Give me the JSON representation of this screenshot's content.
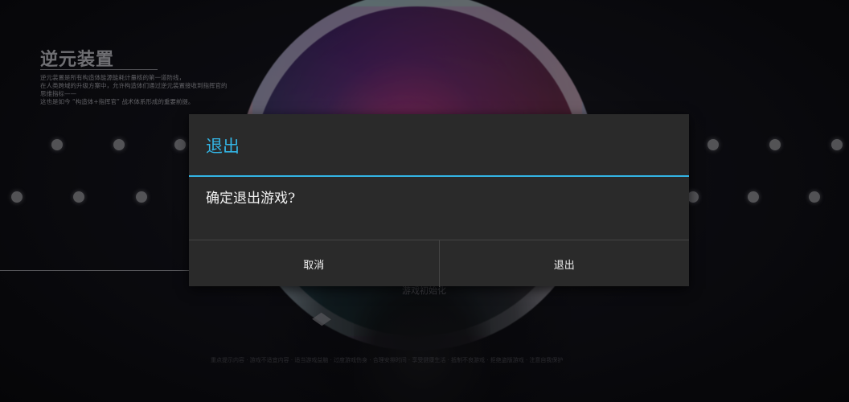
{
  "background": {
    "intro_title": "逆元装置",
    "intro_lines": [
      "逆元装置是所有构造体能源能耗计量核的第一道防线，",
      "在人类跨域的升级方案中，允许构造体们通过逆元装置接收到指挥官的",
      "思维指标——",
      "这也是如今 “构造体+指挥官” 战术体系形成的重要前提。"
    ],
    "loading_text": "游戏初始化",
    "footer_text": "重点提示内容  ·  游戏不适宜内容  ·  适当游戏益脑  ·  过度游戏伤身  ·  合理安排时间  ·  享受健康生活  ·  抵制不良游戏  ·  拒绝盗版游戏  ·  注意自我保护"
  },
  "dialog": {
    "title": "退出",
    "message": "确定退出游戏?",
    "cancel_label": "取消",
    "confirm_label": "退出"
  },
  "colors": {
    "accent": "#33b5e5",
    "dialog_bg": "#2a2a2a",
    "text": "#f2f2f2"
  }
}
